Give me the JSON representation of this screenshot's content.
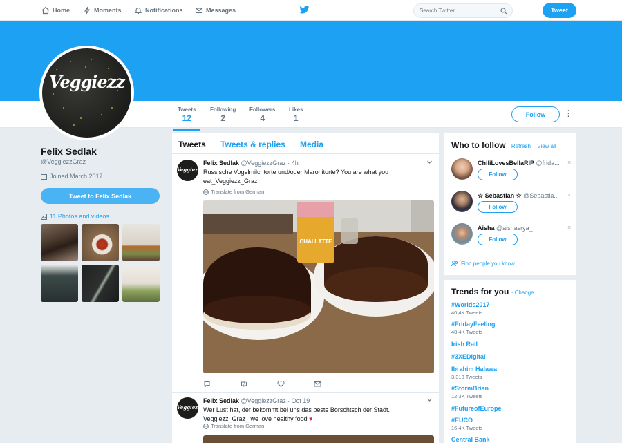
{
  "nav": {
    "home": "Home",
    "moments": "Moments",
    "notifications": "Notifications",
    "messages": "Messages",
    "search_placeholder": "Search Twitter",
    "tweet_button": "Tweet"
  },
  "profile": {
    "avatar_text": "Veggiezz",
    "name": "Felix Sedlak",
    "handle": "@VeggiezzGraz",
    "joined": "Joined March 2017",
    "tweet_to_button": "Tweet to Felix Sedlak",
    "photos_link": "11 Photos and videos"
  },
  "stats": [
    {
      "label": "Tweets",
      "value": "12"
    },
    {
      "label": "Following",
      "value": "2"
    },
    {
      "label": "Followers",
      "value": "4"
    },
    {
      "label": "Likes",
      "value": "1"
    }
  ],
  "follow_button": "Follow",
  "timeline": {
    "tabs": [
      "Tweets",
      "Tweets & replies",
      "Media"
    ],
    "tweets": [
      {
        "name": "Felix Sedlak",
        "meta": "@VeggiezzGraz · 4h",
        "text": "Russische Vogelmilchtorte und/oder Maronitorte? You are what you eat_Veggiezz_Graz",
        "translate": "Translate from German",
        "photo_label": "CHAI LATTE"
      },
      {
        "name": "Felix Sedlak",
        "meta": "@VeggiezzGraz · Oct 19",
        "text": "Wer Lust hat, der bekommt bei uns das beste Borschtsch der Stadt. Veggiezz_Graz_ we love healthy food",
        "translate": "Translate from German"
      }
    ]
  },
  "who_to_follow": {
    "title": "Who to follow",
    "refresh": "Refresh",
    "view_all": "View all",
    "separator": "·",
    "users": [
      {
        "name": "ChiliLovesBellaRIP",
        "handle": "@frida..."
      },
      {
        "name": "☆ Sebastian ☆",
        "handle": "@Sebastia..."
      },
      {
        "name": "Aisha",
        "handle": "@aishasrya_"
      }
    ],
    "follow_label": "Follow",
    "find_people": "Find people you know"
  },
  "trends": {
    "title": "Trends for you",
    "change": "Change",
    "items": [
      {
        "name": "#Worlds2017",
        "count": "40.4K Tweets"
      },
      {
        "name": "#FridayFeeling",
        "count": "48.4K Tweets"
      },
      {
        "name": "Irish Rail",
        "count": ""
      },
      {
        "name": "#3XEDigital",
        "count": ""
      },
      {
        "name": "Ibrahim Halawa",
        "count": "3,313 Tweets"
      },
      {
        "name": "#StormBrian",
        "count": "12.3K Tweets"
      },
      {
        "name": "#FutureofEurope",
        "count": ""
      },
      {
        "name": "#EUCO",
        "count": "16.4K Tweets"
      },
      {
        "name": "Central Bank",
        "count": ""
      }
    ]
  },
  "colors": {
    "accent": "#1da1f2",
    "background": "#e6ecf0"
  }
}
